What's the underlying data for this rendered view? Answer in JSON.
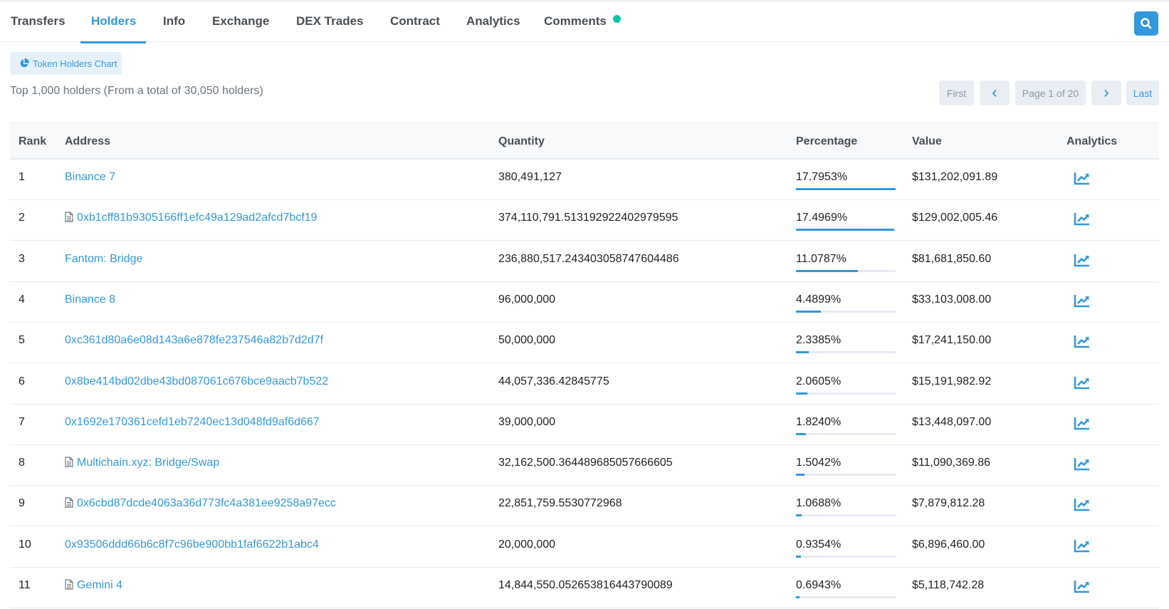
{
  "tabs": [
    {
      "label": "Transfers",
      "active": false
    },
    {
      "label": "Holders",
      "active": true
    },
    {
      "label": "Info",
      "active": false
    },
    {
      "label": "Exchange",
      "active": false
    },
    {
      "label": "DEX Trades",
      "active": false
    },
    {
      "label": "Contract",
      "active": false
    },
    {
      "label": "Analytics",
      "active": false
    },
    {
      "label": "Comments",
      "active": false
    }
  ],
  "icons": {
    "search": "search-icon",
    "chart": "pie-chart-icon",
    "contract": "file-icon",
    "analytics": "trending-up-icon"
  },
  "colors": {
    "accent": "#3498db",
    "notification_dot": "#00c9a7"
  },
  "holders_chart_button": "Token Holders Chart",
  "summary": "Top 1,000 holders (From a total of 30,050 holders)",
  "pager": {
    "first": "First",
    "page_label": "Page 1 of 20",
    "last": "Last"
  },
  "table": {
    "headers": {
      "rank": "Rank",
      "address": "Address",
      "quantity": "Quantity",
      "percentage": "Percentage",
      "value": "Value",
      "analytics": "Analytics"
    },
    "rows": [
      {
        "rank": "1",
        "address": "Binance 7",
        "is_contract": false,
        "quantity": "380,491,127",
        "percentage": "17.7953%",
        "pct_fill": 100,
        "value": "$131,202,091.89"
      },
      {
        "rank": "2",
        "address": "0xb1cff81b9305166ff1efc49a129ad2afcd7bcf19",
        "is_contract": true,
        "quantity": "374,110,791.513192922402979595",
        "percentage": "17.4969%",
        "pct_fill": 98.3,
        "value": "$129,002,005.46"
      },
      {
        "rank": "3",
        "address": "Fantom: Bridge",
        "is_contract": false,
        "quantity": "236,880,517.243403058747604486",
        "percentage": "11.0787%",
        "pct_fill": 62.3,
        "value": "$81,681,850.60"
      },
      {
        "rank": "4",
        "address": "Binance 8",
        "is_contract": false,
        "quantity": "96,000,000",
        "percentage": "4.4899%",
        "pct_fill": 25.2,
        "value": "$33,103,008.00"
      },
      {
        "rank": "5",
        "address": "0xc361d80a6e08d143a6e878fe237546a82b7d2d7f",
        "is_contract": false,
        "quantity": "50,000,000",
        "percentage": "2.3385%",
        "pct_fill": 13.1,
        "value": "$17,241,150.00"
      },
      {
        "rank": "6",
        "address": "0x8be414bd02dbe43bd087061c676bce9aacb7b522",
        "is_contract": false,
        "quantity": "44,057,336.42845775",
        "percentage": "2.0605%",
        "pct_fill": 11.6,
        "value": "$15,191,982.92"
      },
      {
        "rank": "7",
        "address": "0x1692e170361cefd1eb7240ec13d048fd9af6d667",
        "is_contract": false,
        "quantity": "39,000,000",
        "percentage": "1.8240%",
        "pct_fill": 10.2,
        "value": "$13,448,097.00"
      },
      {
        "rank": "8",
        "address": "Multichain.xyz: Bridge/Swap",
        "is_contract": true,
        "quantity": "32,162,500.364489685057666605",
        "percentage": "1.5042%",
        "pct_fill": 8.5,
        "value": "$11,090,369.86"
      },
      {
        "rank": "9",
        "address": "0x6cbd87dcde4063a36d773fc4a381ee9258a97ecc",
        "is_contract": true,
        "quantity": "22,851,759.5530772968",
        "percentage": "1.0688%",
        "pct_fill": 6.0,
        "value": "$7,879,812.28"
      },
      {
        "rank": "10",
        "address": "0x93506ddd66b6c8f7c96be900bb1faf6622b1abc4",
        "is_contract": false,
        "quantity": "20,000,000",
        "percentage": "0.9354%",
        "pct_fill": 5.3,
        "value": "$6,896,460.00"
      },
      {
        "rank": "11",
        "address": "Gemini 4",
        "is_contract": true,
        "quantity": "14,844,550.052653816443790089",
        "percentage": "0.6943%",
        "pct_fill": 3.9,
        "value": "$5,118,742.28"
      }
    ]
  }
}
